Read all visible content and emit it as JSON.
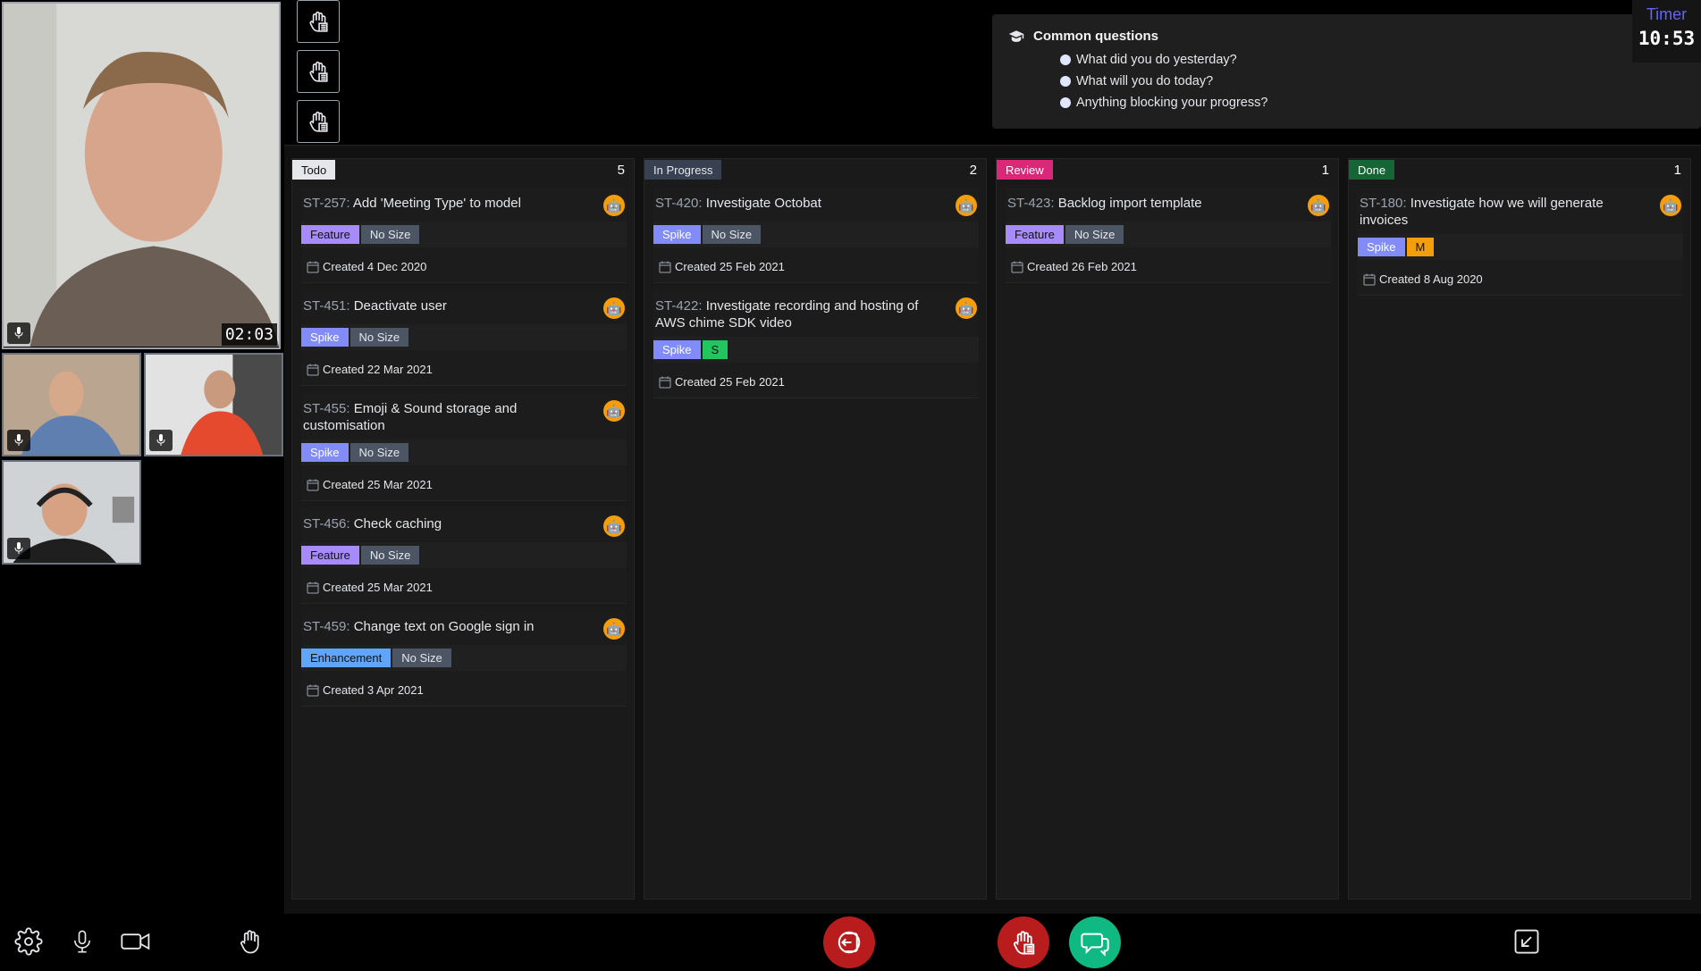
{
  "colors": {
    "todo": "#e5e7eb",
    "in_progress": "#374151",
    "review": "#db2777",
    "done": "#166534",
    "leave": "#b91c1c",
    "hand": "#b91c1c",
    "chat": "#10b981",
    "timer_label": "#6366f1"
  },
  "video": {
    "speaker_time": "02:03"
  },
  "timer": {
    "label": "Timer",
    "value": "10:53"
  },
  "questions": {
    "title": "Common questions",
    "items": [
      "What did you do yesterday?",
      "What will you do today?",
      "Anything blocking your progress?"
    ]
  },
  "board": {
    "columns": [
      {
        "label": "Todo",
        "count": "5",
        "cards": [
          {
            "key": "ST-257:",
            "title": "Add 'Meeting Type' to model",
            "type": "Feature",
            "size": "No Size",
            "created": "Created 4 Dec 2020"
          },
          {
            "key": "ST-451:",
            "title": "Deactivate user",
            "type": "Spike",
            "size": "No Size",
            "created": "Created 22 Mar 2021"
          },
          {
            "key": "ST-455:",
            "title": "Emoji & Sound storage and customisation",
            "type": "Spike",
            "size": "No Size",
            "created": "Created 25 Mar 2021"
          },
          {
            "key": "ST-456:",
            "title": "Check caching",
            "type": "Feature",
            "size": "No Size",
            "created": "Created 25 Mar 2021"
          },
          {
            "key": "ST-459:",
            "title": "Change text on Google sign in",
            "type": "Enhancement",
            "size": "No Size",
            "created": "Created 3 Apr 2021"
          }
        ]
      },
      {
        "label": "In Progress",
        "count": "2",
        "cards": [
          {
            "key": "ST-420:",
            "title": "Investigate Octobat",
            "type": "Spike",
            "size": "No Size",
            "created": "Created 25 Feb 2021"
          },
          {
            "key": "ST-422:",
            "title": "Investigate recording and hosting of AWS chime SDK video",
            "type": "Spike",
            "size": "S",
            "created": "Created 25 Feb 2021"
          }
        ]
      },
      {
        "label": "Review",
        "count": "1",
        "cards": [
          {
            "key": "ST-423:",
            "title": "Backlog import template",
            "type": "Feature",
            "size": "No Size",
            "created": "Created 26 Feb 2021"
          }
        ]
      },
      {
        "label": "Done",
        "count": "1",
        "cards": [
          {
            "key": "ST-180:",
            "title": "Investigate how we will generate invoices",
            "type": "Spike",
            "size": "M",
            "created": "Created 8 Aug 2020"
          }
        ]
      }
    ]
  },
  "icons": {
    "settings": "gear-icon",
    "mic": "microphone-icon",
    "camera": "video-camera-icon",
    "hand": "raise-hand-icon",
    "leave": "leave-icon",
    "chat": "chat-icon",
    "minimize": "minimize-icon"
  }
}
